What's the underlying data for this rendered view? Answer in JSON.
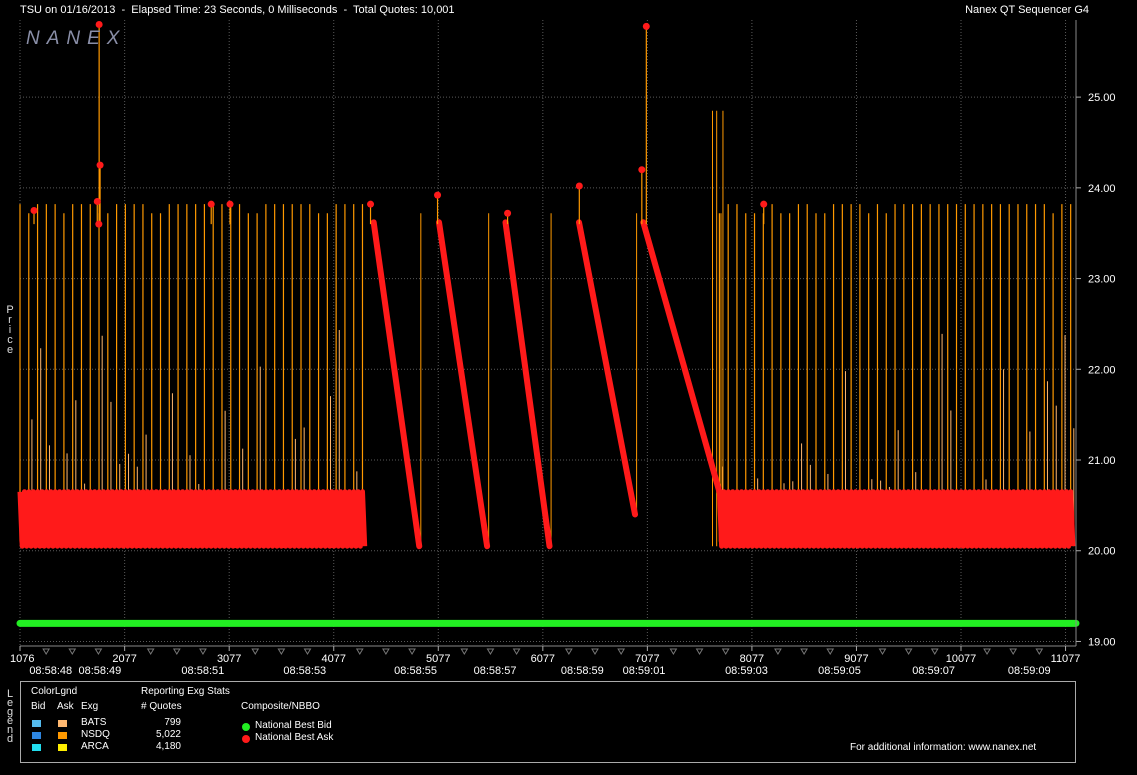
{
  "header": {
    "left_text": "TSU on 01/16/2013  -  Elapsed Time: 23 Seconds, 0 Milliseconds  -  Total Quotes: 10,001",
    "right_text": "Nanex QT Sequencer G4"
  },
  "watermark": "NANEX",
  "side_labels": {
    "price": "Price",
    "legend": "Legend"
  },
  "colors": {
    "background": "#000000",
    "grid": "#5a5a5a",
    "axis_text": "#ffffff",
    "nsdq_quote": "#FF9900",
    "bats_quote": "#FFB870",
    "best_ask": "#FF1A1A",
    "best_bid": "#22EE22",
    "watermark": "#8a8fa8"
  },
  "chart_data": {
    "type": "line",
    "title": "",
    "xlabel": "",
    "ylabel": "Price",
    "grid": true,
    "ylim": [
      18.95,
      25.85
    ],
    "xlim": [
      1076,
      11177
    ],
    "y_ticks": [
      "19.00",
      "20.00",
      "21.00",
      "22.00",
      "23.00",
      "24.00",
      "25.00"
    ],
    "x_ticks": [
      "1076",
      "2077",
      "3077",
      "4077",
      "5077",
      "6077",
      "7077",
      "8077",
      "9077",
      "10077",
      "11077"
    ],
    "time_ticks": [
      {
        "q": 1370,
        "label": "08:58:48"
      },
      {
        "q": 1840,
        "label": "08:58:49"
      },
      {
        "q": 2825,
        "label": "08:58:51"
      },
      {
        "q": 3800,
        "label": "08:58:53"
      },
      {
        "q": 4860,
        "label": "08:58:55"
      },
      {
        "q": 5620,
        "label": "08:58:57"
      },
      {
        "q": 6455,
        "label": "08:58:59"
      },
      {
        "q": 7045,
        "label": "08:59:01"
      },
      {
        "q": 8025,
        "label": "08:59:03"
      },
      {
        "q": 8915,
        "label": "08:59:05"
      },
      {
        "q": 9815,
        "label": "08:59:07"
      },
      {
        "q": 10730,
        "label": "08:59:09"
      }
    ],
    "series": [
      {
        "name": "National Best Bid",
        "color": "#22EE22",
        "points": [
          [
            1076,
            19.2
          ],
          [
            11177,
            19.2
          ]
        ]
      },
      {
        "name": "National Best Ask",
        "color": "#FF1A1A",
        "ramps": [
          {
            "start": 4459,
            "end": 4895,
            "from": 23.62,
            "to": 20.05
          },
          {
            "start": 5084,
            "end": 5544,
            "from": 23.62,
            "to": 20.05
          },
          {
            "start": 5720,
            "end": 6141,
            "from": 23.62,
            "to": 20.05
          },
          {
            "start": 6423,
            "end": 6959,
            "from": 23.62,
            "to": 20.4
          },
          {
            "start": 7038,
            "end": 7766,
            "from": 23.62,
            "to": 20.65
          }
        ],
        "oscillation_ranges": [
          [
            1076,
            4374
          ],
          [
            7766,
            11158
          ]
        ],
        "oscillation_values": [
          20.05,
          20.65
        ],
        "spikes": [
          {
            "q": 1210,
            "value": 23.75
          },
          {
            "q": 1833,
            "value": 25.8
          },
          {
            "q": 1842,
            "value": 24.25
          },
          {
            "q": 1815,
            "value": 23.85
          },
          {
            "q": 1830,
            "value": 23.6
          },
          {
            "q": 2905,
            "value": 23.82
          },
          {
            "q": 3085,
            "value": 23.82
          },
          {
            "q": 4429,
            "value": 23.82
          },
          {
            "q": 5070,
            "value": 23.92
          },
          {
            "q": 5740,
            "value": 23.72
          },
          {
            "q": 6426,
            "value": 24.02
          },
          {
            "q": 7024,
            "value": 24.2
          },
          {
            "q": 7067,
            "value": 25.78
          },
          {
            "q": 8190,
            "value": 23.82
          }
        ]
      }
    ],
    "exchange_quotes": {
      "name": "NSDQ",
      "color": "#FF9900",
      "spike_level": 23.82,
      "base_range": [
        20.05,
        20.65
      ]
    }
  },
  "legend": {
    "header_col1": "ColorLgnd",
    "header_col2": "Reporting Exg Stats",
    "subheaders": [
      "Bid",
      "Ask",
      "Exg",
      "# Quotes",
      "Composite/NBBO"
    ],
    "exchanges": [
      {
        "name": "BATS",
        "quotes": "799",
        "bid_color": "#55BBEE",
        "ask_color": "#FFB870"
      },
      {
        "name": "NSDQ",
        "quotes": "5,022",
        "bid_color": "#2E86E0",
        "ask_color": "#FF9900"
      },
      {
        "name": "ARCA",
        "quotes": "4,180",
        "bid_color": "#22DDEE",
        "ask_color": "#FFEE00"
      }
    ],
    "composite": [
      {
        "label": "National Best Bid",
        "color": "#22EE22"
      },
      {
        "label": "National Best Ask",
        "color": "#FF1A1A"
      }
    ],
    "footer": "For additional information: www.nanex.net"
  }
}
